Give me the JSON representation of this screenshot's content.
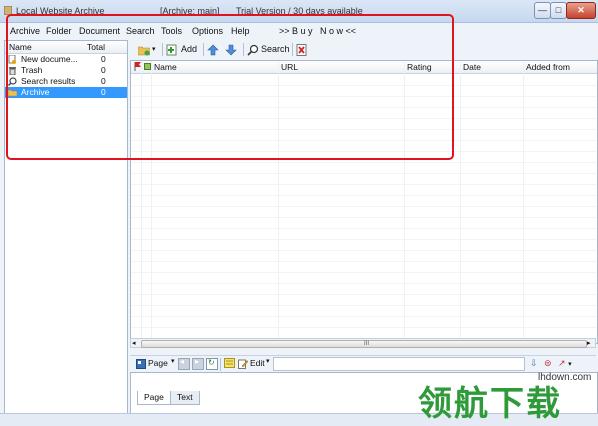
{
  "window": {
    "title": "Local Website Archive",
    "archive_label": "[Archive: main]",
    "trial_label": "Trial Version / 30 days available",
    "minimize_label": "—",
    "maximize_label": "□",
    "close_label": "✕"
  },
  "menu": {
    "items": [
      "Archive",
      "Folder",
      "Document",
      "Search",
      "Tools",
      "Options",
      "Help"
    ],
    "buy_now": ">> B u y   N o w <<"
  },
  "sidebar": {
    "header": {
      "name": "Name",
      "total": "Total"
    },
    "items": [
      {
        "label": "New docume...",
        "count": "0",
        "icon": "new-document-icon"
      },
      {
        "label": "Trash",
        "count": "0",
        "icon": "trash-icon"
      },
      {
        "label": "Search results",
        "count": "0",
        "icon": "search-icon"
      },
      {
        "label": "Archive",
        "count": "0",
        "icon": "folder-icon",
        "selected": true
      }
    ]
  },
  "toolbar": {
    "add_label": "Add",
    "search_label": "Search"
  },
  "grid": {
    "columns": [
      "Name",
      "URL",
      "Rating",
      "Date",
      "Added from"
    ]
  },
  "scrollbar": {
    "grip": "III"
  },
  "page_toolbar": {
    "page_label": "Page",
    "edit_label": "Edit"
  },
  "tabs": [
    "Page",
    "Text"
  ],
  "watermark": {
    "url": "lhdown.com",
    "cn": "领航下载"
  },
  "colors": {
    "highlight": "#e0141e",
    "selection": "#3399ff",
    "watermark": "#2f9a3a"
  }
}
